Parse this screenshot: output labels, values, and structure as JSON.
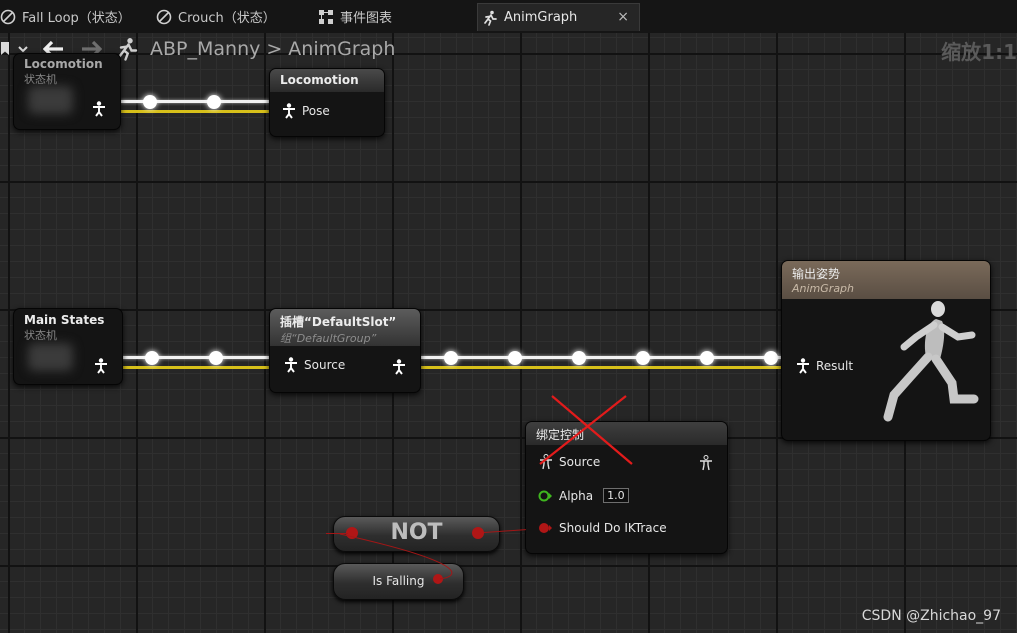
{
  "tabs": [
    {
      "label": "Fall Loop（状态）",
      "icon": "state-icon"
    },
    {
      "label": "Crouch（状态）",
      "icon": "state-icon"
    },
    {
      "label": "事件图表",
      "icon": "event-graph-icon"
    },
    {
      "label": "AnimGraph",
      "icon": "running-man-icon",
      "active": true
    }
  ],
  "tab_close": "×",
  "breadcrumb": {
    "asset": "ABP_Manny",
    "separator": ">",
    "graph": "AnimGraph"
  },
  "zoom_label": "缩放1:1",
  "nodes": {
    "locomotion_sm": {
      "title": "Locomotion",
      "subtitle": "状态机"
    },
    "locomotion_cache": {
      "title": "Locomotion",
      "pin": "Pose"
    },
    "main_states": {
      "title": "Main States",
      "subtitle": "状态机"
    },
    "slot": {
      "title": "插槽“DefaultSlot”",
      "subtitle": "组“DefaultGroup”",
      "pin": "Source"
    },
    "output": {
      "title": "输出姿势",
      "subtitle": "AnimGraph",
      "pin": "Result"
    },
    "control_rig": {
      "title": "绑定控制",
      "pin_source": "Source",
      "pin_alpha": "Alpha",
      "alpha_value": "1.0",
      "pin_trace": "Should Do IKTrace",
      "disabled_mark": "red-cross"
    },
    "not": {
      "title": "NOT"
    },
    "is_falling": {
      "title": "Is Falling"
    }
  },
  "colors": {
    "pose_wire": "#ffffff",
    "exec_wire": "#d7c01a",
    "bool_pin": "#b01616",
    "float_pin": "#3fb61f",
    "output_header": "#6b5d4f"
  },
  "watermark": "CSDN @Zhichao_97"
}
